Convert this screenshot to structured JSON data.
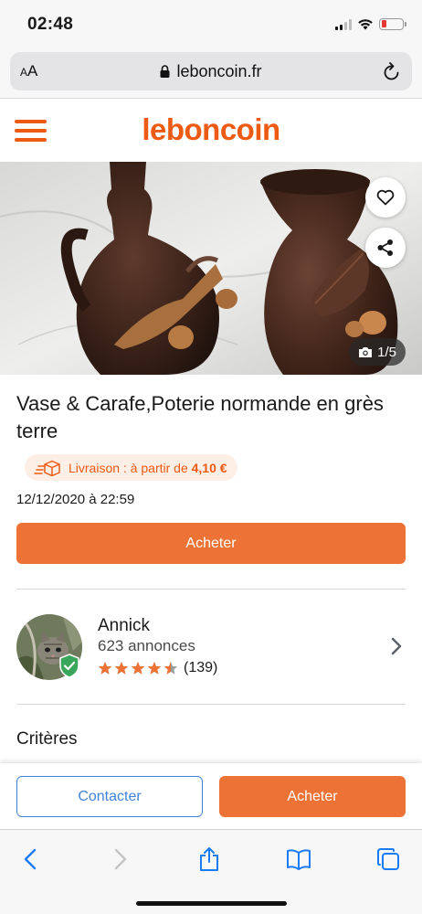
{
  "status_bar": {
    "time": "02:48",
    "icons": [
      "signal-icon",
      "wifi-icon",
      "battery-low-icon"
    ],
    "battery_color": "#e53935"
  },
  "browser": {
    "text_size_label": "AA",
    "url": "leboncoin.fr",
    "icons": [
      "lock-icon",
      "reload-icon"
    ]
  },
  "site_header": {
    "logo_text": "leboncoin",
    "brand_color": "#ec5a13",
    "menu_icon": "hamburger-menu-icon"
  },
  "photo": {
    "counter": "1/5",
    "icons": [
      "heart-icon",
      "share-icon",
      "camera-icon"
    ]
  },
  "listing": {
    "title": "Vase & Carafe,Poterie normande en grès terre",
    "delivery_label": "Livraison : à partir de",
    "delivery_price": "4,10 €",
    "date": "12/12/2020 à 22:59",
    "buy_label": "Acheter"
  },
  "seller": {
    "name": "Annick",
    "ads_count": "623 annonces",
    "rating": 4.5,
    "review_count": "(139)",
    "star_color": "#ec7335"
  },
  "criteria": {
    "title": "Critères"
  },
  "sticky_bar": {
    "contact_label": "Contacter",
    "buy_label": "Acheter",
    "contact_color": "#4183d7",
    "buy_color": "#ec7335"
  },
  "safari_toolbar": {
    "icons": [
      "back-icon",
      "forward-icon",
      "share-icon",
      "bookmarks-icon",
      "tabs-icon"
    ],
    "accent_color": "#1a7cf5"
  }
}
